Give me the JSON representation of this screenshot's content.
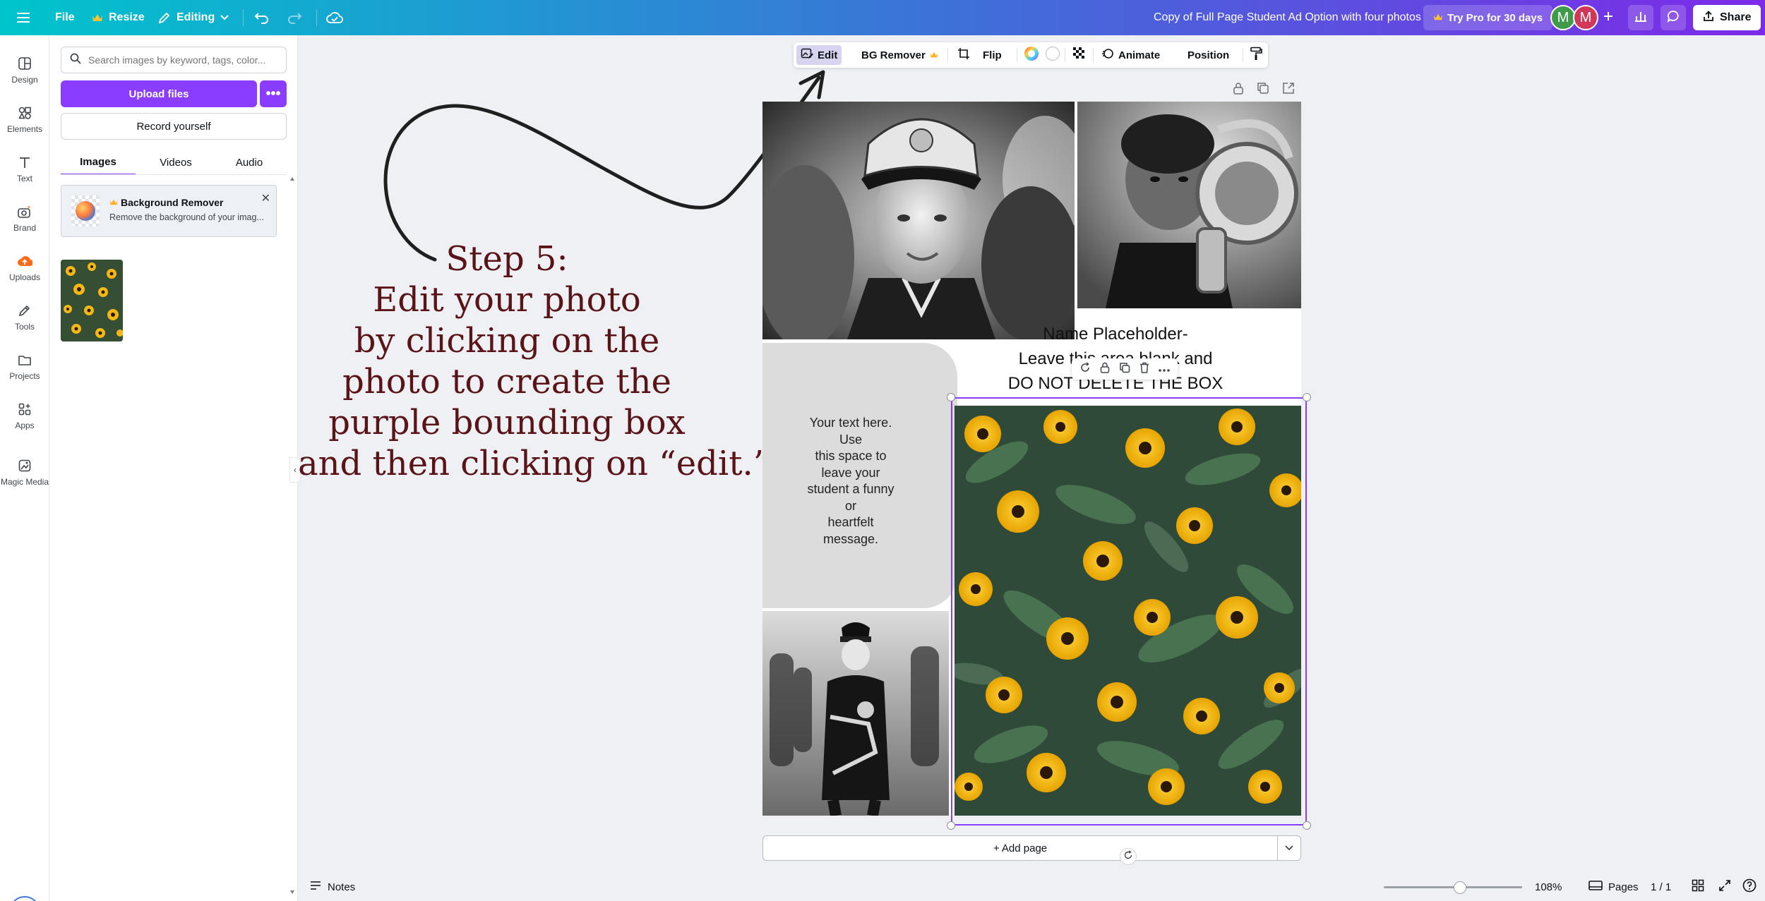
{
  "topbar": {
    "file_label": "File",
    "resize_label": "Resize",
    "editing_label": "Editing",
    "doc_title": "Copy of Full Page Student Ad Option with four photos",
    "pro_label": "Try Pro for 30 days",
    "avatar1": "M",
    "avatar2": "M",
    "share_label": "Share",
    "colors": {
      "avatar1": "#3f9a4a",
      "avatar2": "#d2375a"
    }
  },
  "rail": {
    "items": [
      {
        "label": "Design",
        "icon": "design-icon"
      },
      {
        "label": "Elements",
        "icon": "elements-icon"
      },
      {
        "label": "Text",
        "icon": "text-icon"
      },
      {
        "label": "Brand",
        "icon": "brand-icon"
      },
      {
        "label": "Uploads",
        "icon": "uploads-icon"
      },
      {
        "label": "Tools",
        "icon": "tools-icon"
      },
      {
        "label": "Projects",
        "icon": "projects-icon"
      },
      {
        "label": "Apps",
        "icon": "apps-icon"
      },
      {
        "label": "Magic Media",
        "icon": "magic-media-icon"
      }
    ]
  },
  "panel": {
    "search_placeholder": "Search images by keyword, tags, color...",
    "upload_label": "Upload files",
    "more_label": "•••",
    "record_label": "Record yourself",
    "tabs": [
      "Images",
      "Videos",
      "Audio"
    ],
    "active_tab": "Images",
    "bg_card_title": "Background Remover",
    "bg_card_desc": "Remove the background of your imag..."
  },
  "context_toolbar": {
    "edit_label": "Edit",
    "bg_remover_label": "BG Remover",
    "flip_label": "Flip",
    "animate_label": "Animate",
    "position_label": "Position"
  },
  "canvas": {
    "instruction_lines": [
      "Step 5:",
      "Edit your photo",
      "by clicking on the",
      "photo to create the",
      "purple bounding box",
      "and then clicking on “edit.”"
    ],
    "message_lines": [
      "Your text here.",
      "Use",
      "this space to",
      "leave your",
      "student a funny",
      "or",
      "heartfelt",
      "message."
    ],
    "name_lines": [
      "Name Placeholder-",
      "Leave this area blank and",
      "DO NOT DELETE THE BOX"
    ],
    "add_page_label": "+ Add page",
    "accent_color": "#8b3dff"
  },
  "bottombar": {
    "notes_label": "Notes",
    "zoom_label": "108%",
    "zoom_fraction": 0.55,
    "pages_label": "Pages",
    "page_count": "1 / 1"
  }
}
